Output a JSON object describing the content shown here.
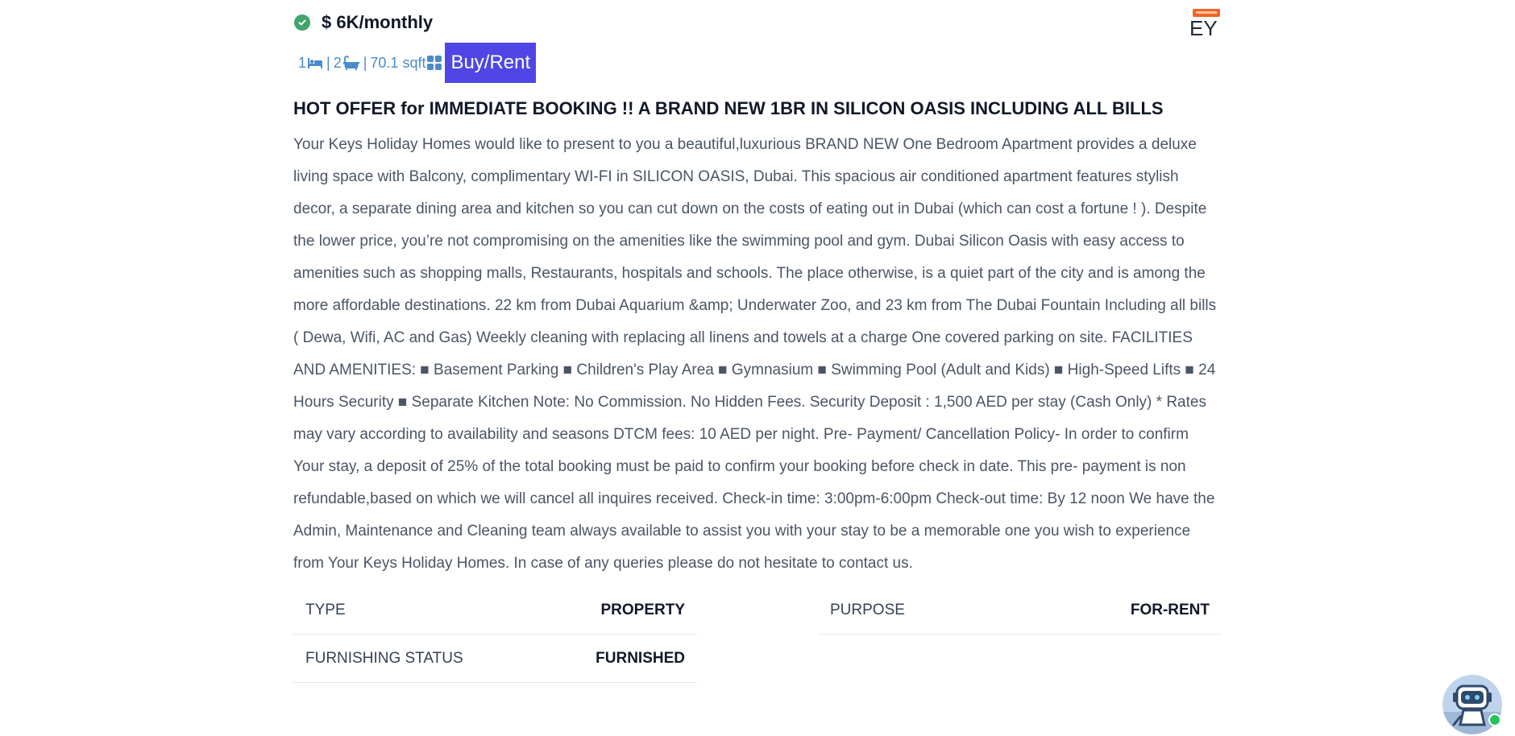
{
  "listing": {
    "price": "$ 6K/monthly",
    "logo_text": "EY",
    "specs": {
      "bedrooms": "1",
      "bathrooms": "2",
      "area": "70.1 sqft",
      "separator": "|"
    },
    "purpose_button": "Buy/Rent",
    "title": "HOT OFFER for IMMEDIATE BOOKING !! A BRAND NEW 1BR IN SILICON OASIS INCLUDING ALL BILLS",
    "description": "Your Keys Holiday Homes would like to present to you a beautiful,luxurious BRAND NEW One Bedroom Apartment provides a deluxe living space with Balcony, complimentary WI-FI in SILICON OASIS, Dubai. This spacious air conditioned apartment features stylish decor, a separate dining area and kitchen so you can cut down on the costs of eating out in Dubai (which can cost a fortune ! ). Despite the lower price, you’re not compromising on the amenities like the swimming pool and gym. Dubai Silicon Oasis with easy access to amenities such as shopping malls, Restaurants, hospitals and schools. The place otherwise, is a quiet part of the city and is among the more affordable destinations. 22 km from Dubai Aquarium &amp; Underwater Zoo, and 23 km from The Dubai Fountain Including all bills ( Dewa, Wifi, AC and Gas) Weekly cleaning with replacing all linens and towels at a charge One covered parking on site. FACILITIES AND AMENITIES: ■ Basement Parking ■ Children's Play Area ■ Gymnasium ■ Swimming Pool (Adult and Kids) ■ High-Speed Lifts ■ 24 Hours Security ■ Separate Kitchen Note: No Commission. No Hidden Fees. Security Deposit : 1,500 AED per stay (Cash Only) * Rates may vary according to availability and seasons DTCM fees: 10 AED per night. Pre- Payment/ Cancellation Policy- In order to confirm Your stay, a deposit of 25% of the total booking must be paid to confirm your booking before check in date. This pre- payment is non refundable,based on which we will cancel all inquires received. Check-in time: 3:00pm-6:00pm Check-out time: By 12 noon We have the Admin, Maintenance and Cleaning team always available to assist you with your stay to be a memorable one you wish to experience from Your Keys Holiday Homes. In case of any queries please do not hesitate to contact us.",
    "details": {
      "type_label": "TYPE",
      "type_value": "PROPERTY",
      "purpose_label": "PURPOSE",
      "purpose_value": "FOR-RENT",
      "furnishing_label": "FURNISHING STATUS",
      "furnishing_value": "FURNISHED"
    }
  },
  "icons": {
    "verified": "check-circle-icon",
    "bed": "bed-icon",
    "bath": "bath-icon",
    "area": "grid-icon",
    "chat": "robot-icon"
  },
  "colors": {
    "verified": "#3fa56b",
    "spec_text": "#4a8cc9",
    "button_bg": "#4f46e5",
    "online_dot": "#22c55e"
  }
}
